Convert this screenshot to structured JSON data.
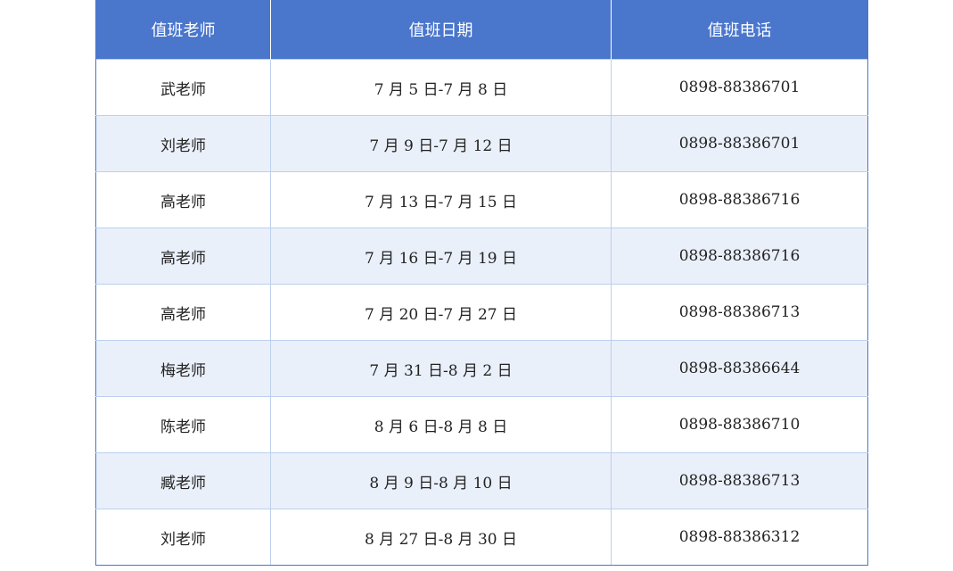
{
  "table": {
    "headers": [
      "值班老师",
      "值班日期",
      "值班电话"
    ],
    "rows": [
      [
        "武老师",
        "7 月 5 日-7 月 8 日",
        "0898-88386701"
      ],
      [
        "刘老师",
        "7 月 9 日-7 月 12 日",
        "0898-88386701"
      ],
      [
        "高老师",
        "7 月 13 日-7 月 15 日",
        "0898-88386716"
      ],
      [
        "高老师",
        "7 月 16 日-7 月 19 日",
        "0898-88386716"
      ],
      [
        "高老师",
        "7 月 20 日-7 月 27 日",
        "0898-88386713"
      ],
      [
        "梅老师",
        "7 月 31 日-8 月 2 日",
        "0898-88386644"
      ],
      [
        "陈老师",
        "8 月 6 日-8 月 8 日",
        "0898-88386710"
      ],
      [
        "臧老师",
        "8 月 9 日-8 月 10 日",
        "0898-88386713"
      ],
      [
        "刘老师",
        "8 月 27 日-8 月 30 日",
        "0898-88386312"
      ]
    ]
  },
  "colors": {
    "header_bg": "#4a76cc",
    "row_alt_bg": "#eaf0fa",
    "border": "#bcd0ee"
  }
}
